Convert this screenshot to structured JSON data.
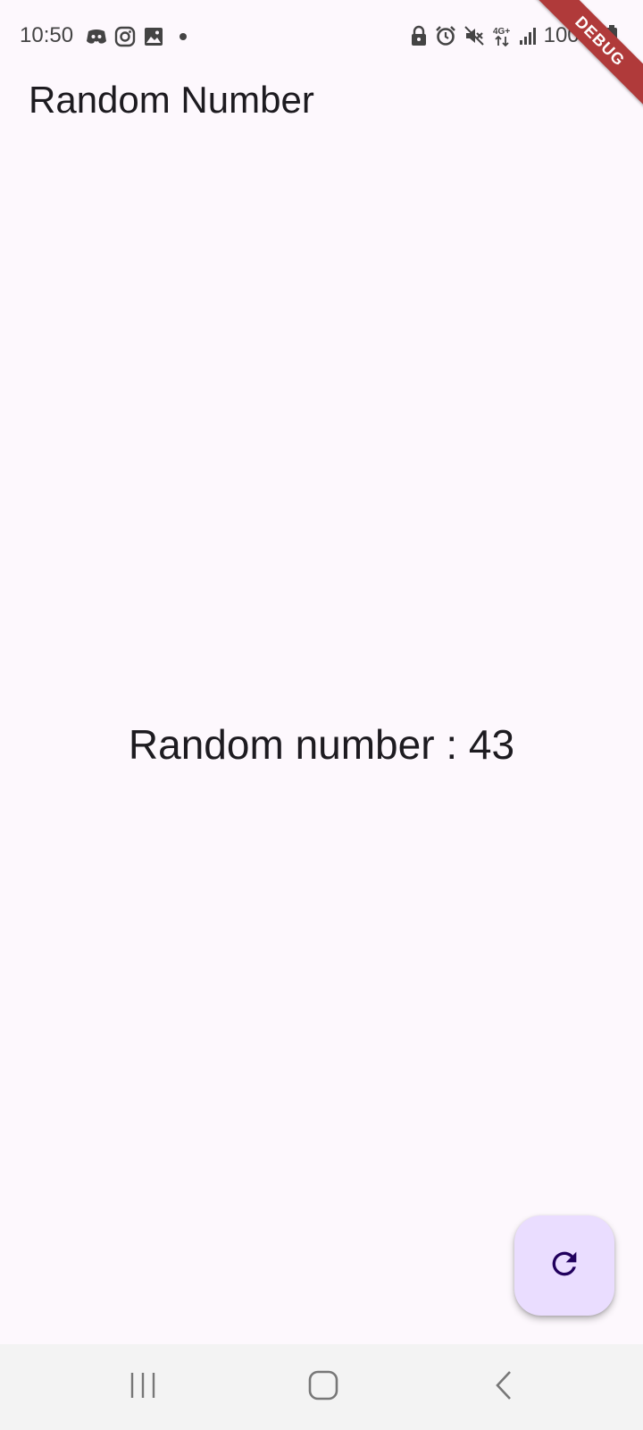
{
  "status_bar": {
    "time": "10:50",
    "battery": "100%",
    "left_icons": [
      "discord-icon",
      "instagram-icon",
      "gallery-icon",
      "notification-dot-icon"
    ],
    "right_icons": [
      "lock-icon",
      "alarm-icon",
      "mute-icon",
      "4g-icon",
      "signal-icon",
      "battery-icon"
    ]
  },
  "debug_banner": "DEBUG",
  "app_bar": {
    "title": "Random Number"
  },
  "main": {
    "text": "Random number : 43"
  },
  "fab": {
    "icon": "refresh-icon",
    "color": "#eaddff"
  },
  "nav_bar": {
    "buttons": [
      "recents-icon",
      "home-icon",
      "back-icon"
    ]
  },
  "colors": {
    "background": "#fdf8fd",
    "text": "#1d1b20",
    "fab_icon": "#21005d",
    "debug": "#b03a3a"
  }
}
